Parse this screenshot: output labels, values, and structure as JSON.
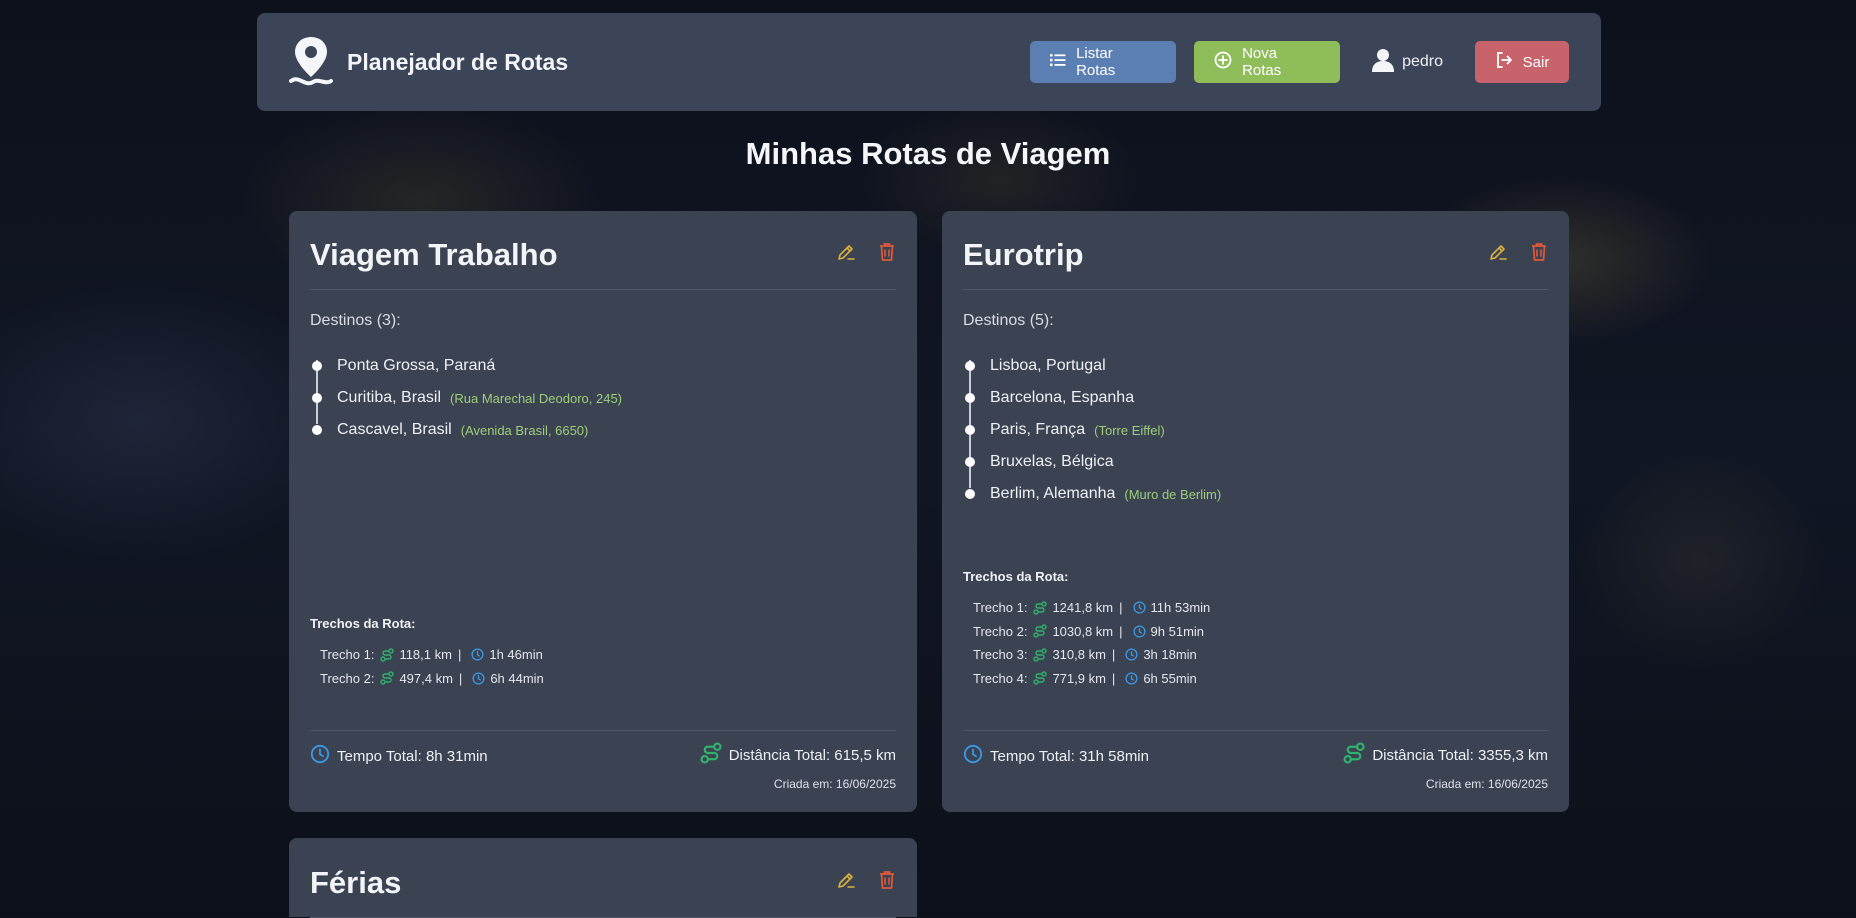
{
  "app": {
    "title": "Planejador de Rotas",
    "logo_icon": "map-pin-route-icon"
  },
  "nav": {
    "list_label": "Listar Rotas",
    "new_label": "Nova Rotas",
    "user_name": "pedro",
    "exit_label": "Sair"
  },
  "colors": {
    "list_button": "#5b7fb3",
    "new_button": "#8fbd5a",
    "exit_button": "#c7636a",
    "edit_icon": "#d9b23c",
    "delete_icon": "#e05a3a",
    "route_icon": "#2fb36b",
    "clock_icon": "#3b9ae8",
    "note_text": "#9ccf7a"
  },
  "page": {
    "title": "Minhas Rotas de Viagem"
  },
  "routes": [
    {
      "name": "Viagem Trabalho",
      "destinations_label": "Destinos (3):",
      "destinations": [
        {
          "name": "Ponta Grossa, Paraná",
          "note": ""
        },
        {
          "name": "Curitiba, Brasil",
          "note": "(Rua Marechal Deodoro, 245)"
        },
        {
          "name": "Cascavel, Brasil",
          "note": "(Avenida Brasil, 6650)"
        }
      ],
      "legs_title": "Trechos da Rota:",
      "legs": [
        {
          "label": "Trecho 1:",
          "distance": "118,1 km",
          "sep": "|",
          "time": "1h 46min"
        },
        {
          "label": "Trecho 2:",
          "distance": "497,4 km",
          "sep": "|",
          "time": "6h 44min"
        }
      ],
      "total_time": "Tempo Total: 8h 31min",
      "total_distance": "Distância Total: 615,5 km",
      "created": "Criada em: 16/06/2025"
    },
    {
      "name": "Eurotrip",
      "destinations_label": "Destinos (5):",
      "destinations": [
        {
          "name": "Lisboa, Portugal",
          "note": ""
        },
        {
          "name": "Barcelona, Espanha",
          "note": ""
        },
        {
          "name": "Paris, França",
          "note": "(Torre Eiffel)"
        },
        {
          "name": "Bruxelas, Bélgica",
          "note": ""
        },
        {
          "name": "Berlim, Alemanha",
          "note": "(Muro de Berlim)"
        }
      ],
      "legs_title": "Trechos da Rota:",
      "legs": [
        {
          "label": "Trecho 1:",
          "distance": "1241,8 km",
          "sep": "|",
          "time": "11h 53min"
        },
        {
          "label": "Trecho 2:",
          "distance": "1030,8 km",
          "sep": "|",
          "time": "9h 51min"
        },
        {
          "label": "Trecho 3:",
          "distance": "310,8 km",
          "sep": "|",
          "time": "3h 18min"
        },
        {
          "label": "Trecho 4:",
          "distance": "771,9 km",
          "sep": "|",
          "time": "6h 55min"
        }
      ],
      "total_time": "Tempo Total: 31h 58min",
      "total_distance": "Distância Total: 3355,3 km",
      "created": "Criada em: 16/06/2025"
    },
    {
      "name": "Férias"
    }
  ]
}
